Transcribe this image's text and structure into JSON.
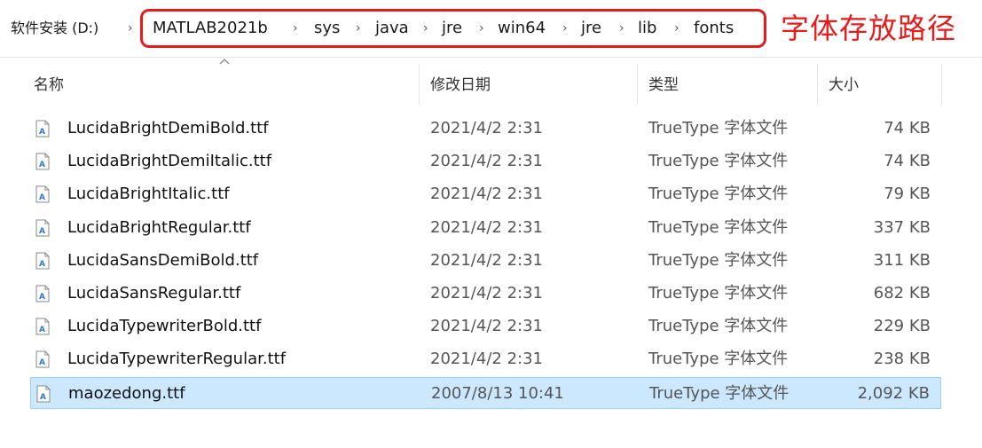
{
  "breadcrumb": {
    "root": "软件安装 (D:)",
    "items": [
      "MATLAB2021b",
      "sys",
      "java",
      "jre",
      "win64",
      "jre",
      "lib",
      "fonts"
    ],
    "separator": "›"
  },
  "annotation": {
    "text": "字体存放路径",
    "color": "#ea1a1a"
  },
  "columns": {
    "name": "名称",
    "date": "修改日期",
    "type": "类型",
    "size": "大小"
  },
  "files": [
    {
      "name": "LucidaBrightDemiBold.ttf",
      "date": "2021/4/2 2:31",
      "type": "TrueType 字体文件",
      "size": "74 KB"
    },
    {
      "name": "LucidaBrightDemiItalic.ttf",
      "date": "2021/4/2 2:31",
      "type": "TrueType 字体文件",
      "size": "74 KB"
    },
    {
      "name": "LucidaBrightItalic.ttf",
      "date": "2021/4/2 2:31",
      "type": "TrueType 字体文件",
      "size": "79 KB"
    },
    {
      "name": "LucidaBrightRegular.ttf",
      "date": "2021/4/2 2:31",
      "type": "TrueType 字体文件",
      "size": "337 KB"
    },
    {
      "name": "LucidaSansDemiBold.ttf",
      "date": "2021/4/2 2:31",
      "type": "TrueType 字体文件",
      "size": "311 KB"
    },
    {
      "name": "LucidaSansRegular.ttf",
      "date": "2021/4/2 2:31",
      "type": "TrueType 字体文件",
      "size": "682 KB"
    },
    {
      "name": "LucidaTypewriterBold.ttf",
      "date": "2021/4/2 2:31",
      "type": "TrueType 字体文件",
      "size": "229 KB"
    },
    {
      "name": "LucidaTypewriterRegular.ttf",
      "date": "2021/4/2 2:31",
      "type": "TrueType 字体文件",
      "size": "238 KB"
    },
    {
      "name": "maozedong.ttf",
      "date": "2007/8/13 10:41",
      "type": "TrueType 字体文件",
      "size": "2,092 KB",
      "selected": true
    }
  ],
  "colors": {
    "selection_bg": "#cce8ff",
    "selection_border": "#99d1ff",
    "icon_accent": "#2b79d6"
  }
}
